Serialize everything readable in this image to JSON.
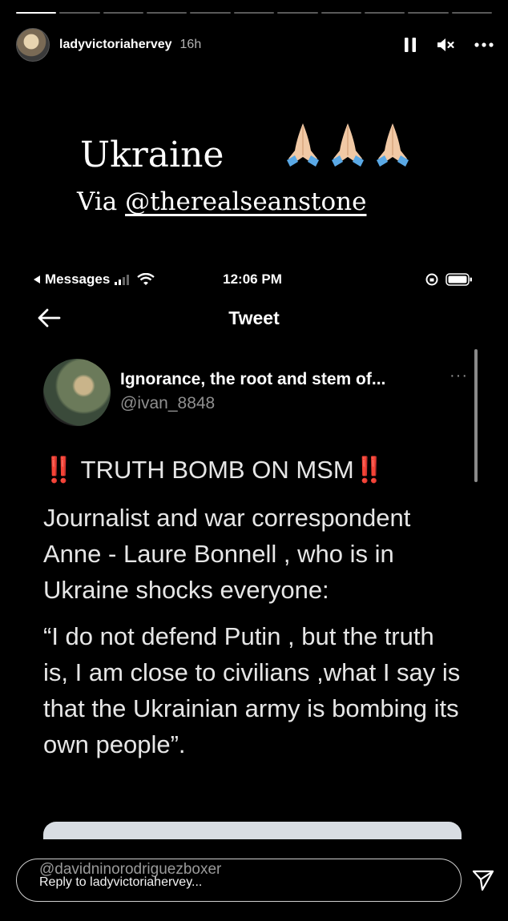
{
  "story": {
    "progress": {
      "segments": 11,
      "active_index": 0
    },
    "username": "ladyvictoriahervey",
    "time_ago": "16h",
    "controls": {
      "pause": "pause-icon",
      "mute": "muted-speaker-icon",
      "more": "more-horizontal-icon"
    }
  },
  "caption": {
    "title": "Ukraine",
    "emoji": "🙏🏼🙏🏼🙏🏼",
    "via_prefix": "Via ",
    "via_mention": "@therealseanstone"
  },
  "screenshot": {
    "status_bar": {
      "back_label": "Messages",
      "time": "12:06 PM"
    },
    "nav": {
      "title": "Tweet",
      "back_icon": "arrow-left-icon"
    },
    "tweet": {
      "author_name": "Ignorance, the root and stem of...",
      "author_handle": "@ivan_8848",
      "more": "···",
      "headline_mark": "‼️",
      "headline": "TRUTH BOMB ON MSM",
      "paragraph1": "Journalist and war correspondent Anne - Laure Bonnell ,  who is in Ukraine shocks everyone:",
      "paragraph2": "“I do not defend Putin , but the truth is, I am close to civilians ,what I say is that the Ukrainian army is bombing its own people”."
    }
  },
  "reply": {
    "mention": "@davidninorodriguezboxer",
    "placeholder": "Reply to ladyvictoriahervey...",
    "send_icon": "send-icon"
  },
  "colors": {
    "background": "#000000",
    "accent_red": "#e0242a",
    "muted_text": "#8f8f8f"
  }
}
